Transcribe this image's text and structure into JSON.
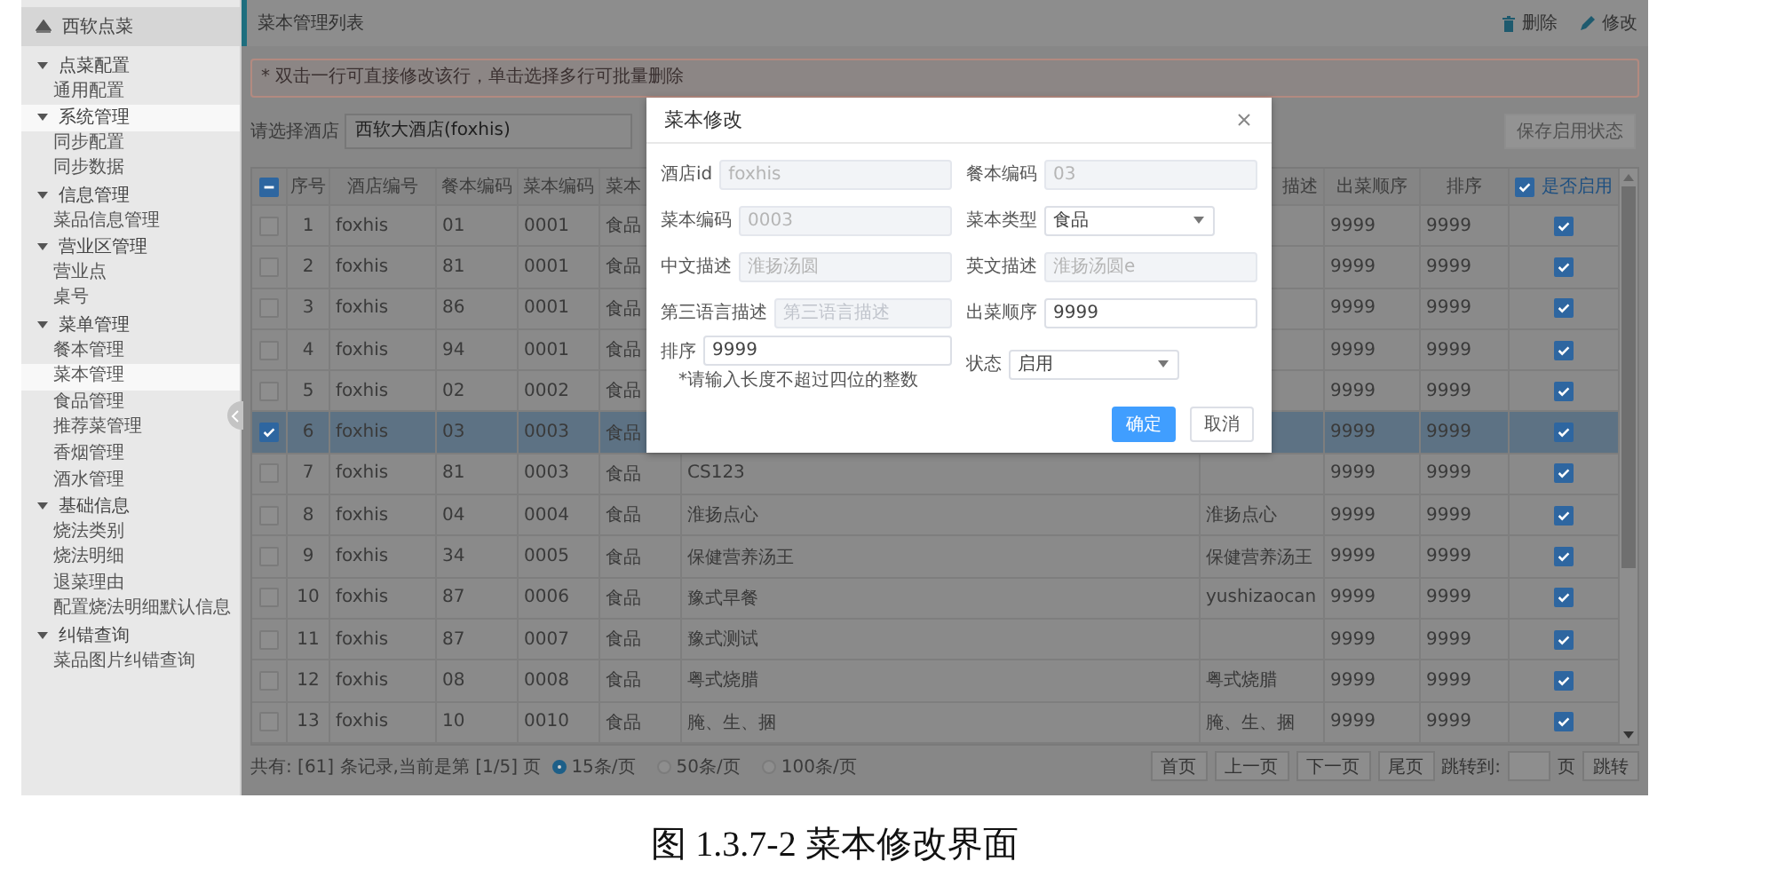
{
  "sidebar": {
    "title": "西软点菜",
    "groups": [
      {
        "label": "点菜配置",
        "expanded": true,
        "selected": false,
        "children": [
          {
            "label": "通用配置",
            "selected": false
          }
        ]
      },
      {
        "label": "系统管理",
        "expanded": true,
        "selected": true,
        "children": [
          {
            "label": "同步配置",
            "selected": false
          },
          {
            "label": "同步数据",
            "selected": false
          }
        ]
      },
      {
        "label": "信息管理",
        "expanded": true,
        "selected": false,
        "children": [
          {
            "label": "菜品信息管理",
            "selected": false
          }
        ]
      },
      {
        "label": "营业区管理",
        "expanded": true,
        "selected": false,
        "children": [
          {
            "label": "营业点",
            "selected": false
          },
          {
            "label": "桌号",
            "selected": false
          }
        ]
      },
      {
        "label": "菜单管理",
        "expanded": true,
        "selected": false,
        "children": [
          {
            "label": "餐本管理",
            "selected": false
          },
          {
            "label": "菜本管理",
            "selected": true
          },
          {
            "label": "食品管理",
            "selected": false
          },
          {
            "label": "推荐菜管理",
            "selected": false
          },
          {
            "label": "香烟管理",
            "selected": false
          },
          {
            "label": "酒水管理",
            "selected": false
          }
        ]
      },
      {
        "label": "基础信息",
        "expanded": true,
        "selected": false,
        "children": [
          {
            "label": "烧法类别",
            "selected": false
          },
          {
            "label": "烧法明细",
            "selected": false
          },
          {
            "label": "退菜理由",
            "selected": false
          },
          {
            "label": "配置烧法明细默认信息",
            "selected": false
          }
        ]
      },
      {
        "label": "纠错查询",
        "expanded": true,
        "selected": false,
        "children": [
          {
            "label": "菜品图片纠错查询",
            "selected": false
          }
        ]
      }
    ]
  },
  "header": {
    "title": "菜本管理列表",
    "actions": [
      {
        "kind": "delete",
        "label": "删除"
      },
      {
        "kind": "edit",
        "label": "修改"
      }
    ]
  },
  "notice": "* 双击一行可直接修改该行，单击选择多行可批量删除",
  "hotel_filter": {
    "label": "请选择酒店",
    "value": "西软大酒店(foxhis)",
    "button": "保存启用状态"
  },
  "table": {
    "select_all_indeterminate": true,
    "columns": [
      "序号",
      "酒店编号",
      "餐本编码",
      "菜本编码",
      "菜本",
      "",
      "描述",
      "出菜顺序",
      "排序"
    ],
    "enabled_column": {
      "label": "是否启用",
      "checked": true
    },
    "rows": [
      {
        "no": "1",
        "hotel": "foxhis",
        "menu_code": "01",
        "dish_code": "0001",
        "type": "食品",
        "order": "9999",
        "sort": "9999",
        "enabled": true,
        "selected": false
      },
      {
        "no": "2",
        "hotel": "foxhis",
        "menu_code": "81",
        "dish_code": "0001",
        "type": "食品",
        "order": "9999",
        "sort": "9999",
        "enabled": true,
        "selected": false
      },
      {
        "no": "3",
        "hotel": "foxhis",
        "menu_code": "86",
        "dish_code": "0001",
        "type": "食品",
        "order": "9999",
        "sort": "9999",
        "enabled": true,
        "selected": false
      },
      {
        "no": "4",
        "hotel": "foxhis",
        "menu_code": "94",
        "dish_code": "0001",
        "type": "食品",
        "order": "9999",
        "sort": "9999",
        "enabled": true,
        "selected": false
      },
      {
        "no": "5",
        "hotel": "foxhis",
        "menu_code": "02",
        "dish_code": "0002",
        "type": "食品",
        "order": "9999",
        "sort": "9999",
        "enabled": true,
        "selected": false
      },
      {
        "no": "6",
        "hotel": "foxhis",
        "menu_code": "03",
        "dish_code": "0003",
        "type": "食品",
        "order": "9999",
        "sort": "9999",
        "enabled": true,
        "selected": true
      },
      {
        "no": "7",
        "hotel": "foxhis",
        "menu_code": "81",
        "dish_code": "0003",
        "type": "食品",
        "cn": "CS123",
        "order": "9999",
        "sort": "9999",
        "enabled": true,
        "selected": false
      },
      {
        "no": "8",
        "hotel": "foxhis",
        "menu_code": "04",
        "dish_code": "0004",
        "type": "食品",
        "cn": "淮扬点心",
        "en": "淮扬点心",
        "order": "9999",
        "sort": "9999",
        "enabled": true,
        "selected": false
      },
      {
        "no": "9",
        "hotel": "foxhis",
        "menu_code": "34",
        "dish_code": "0005",
        "type": "食品",
        "cn": "保健营养汤王",
        "en": "保健营养汤王",
        "order": "9999",
        "sort": "9999",
        "enabled": true,
        "selected": false
      },
      {
        "no": "10",
        "hotel": "foxhis",
        "menu_code": "87",
        "dish_code": "0006",
        "type": "食品",
        "cn": "豫式早餐",
        "en": "yushizaocan",
        "order": "9999",
        "sort": "9999",
        "enabled": true,
        "selected": false
      },
      {
        "no": "11",
        "hotel": "foxhis",
        "menu_code": "87",
        "dish_code": "0007",
        "type": "食品",
        "cn": "豫式测试",
        "order": "9999",
        "sort": "9999",
        "enabled": true,
        "selected": false
      },
      {
        "no": "12",
        "hotel": "foxhis",
        "menu_code": "08",
        "dish_code": "0008",
        "type": "食品",
        "cn": "粤式烧腊",
        "en": "粤式烧腊",
        "order": "9999",
        "sort": "9999",
        "enabled": true,
        "selected": false
      },
      {
        "no": "13",
        "hotel": "foxhis",
        "menu_code": "10",
        "dish_code": "0010",
        "type": "食品",
        "cn": "腌、生、捆",
        "en": "腌、生、捆",
        "order": "9999",
        "sort": "9999",
        "enabled": true,
        "selected": false
      }
    ]
  },
  "footer": {
    "summary": "共有: [61] 条记录,当前是第 [1/5] 页",
    "page_sizes": [
      {
        "label": "15条/页",
        "selected": true
      },
      {
        "label": "50条/页",
        "selected": false
      },
      {
        "label": "100条/页",
        "selected": false
      }
    ],
    "pager": [
      "首页",
      "上一页",
      "下一页",
      "尾页"
    ],
    "jump_label": "跳转到:",
    "jump_unit": "页",
    "jump_button": "跳转"
  },
  "dialog": {
    "title": "菜本修改",
    "fields": [
      {
        "label": "酒店id",
        "kind": "input",
        "disabled": true,
        "value": "foxhis"
      },
      {
        "label": "餐本编码",
        "kind": "input",
        "disabled": true,
        "value": "03"
      },
      {
        "label": "菜本编码",
        "kind": "input",
        "disabled": true,
        "value": "0003"
      },
      {
        "label": "菜本类型",
        "kind": "select",
        "disabled": false,
        "value": "食品"
      },
      {
        "label": "中文描述",
        "kind": "input",
        "disabled": true,
        "value": "淮扬汤圆"
      },
      {
        "label": "英文描述",
        "kind": "input",
        "disabled": true,
        "value": "淮扬汤圆e"
      },
      {
        "label": "第三语言描述",
        "kind": "input",
        "disabled": true,
        "placeholder": "第三语言描述"
      },
      {
        "label": "出菜顺序",
        "kind": "input",
        "disabled": false,
        "value": "9999"
      },
      {
        "label": "排序",
        "kind": "input",
        "disabled": false,
        "value": "9999",
        "hint": "*请输入长度不超过四位的整数"
      },
      {
        "label": "状态",
        "kind": "select",
        "disabled": false,
        "value": "启用"
      }
    ],
    "buttons": [
      {
        "label": "确定",
        "primary": true
      },
      {
        "label": "取消",
        "primary": false
      }
    ]
  },
  "caption": "图 1.3.7-2 菜本修改界面"
}
